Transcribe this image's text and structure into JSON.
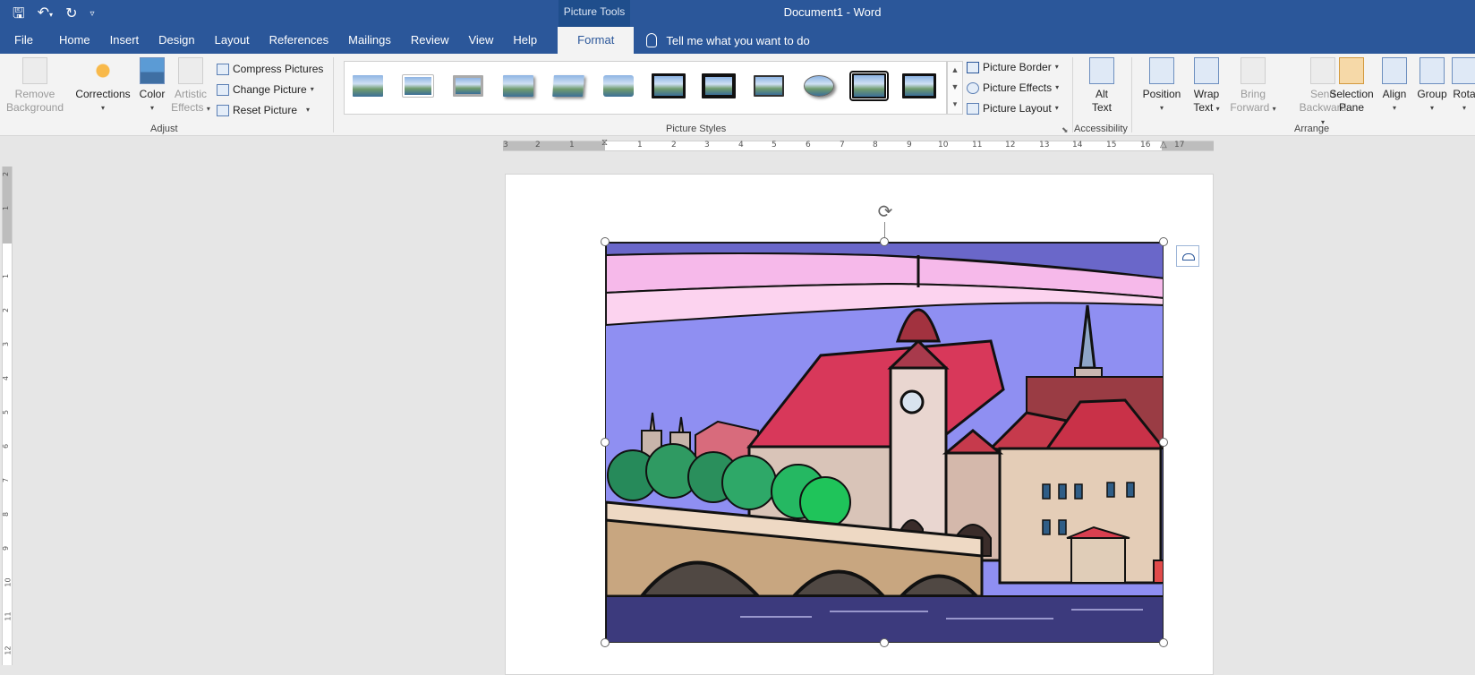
{
  "window": {
    "contextual_tab_group": "Picture Tools",
    "title": "Document1  -  Word",
    "qat_icons": [
      "save-icon",
      "undo-icon",
      "redo-icon",
      "customize-icon"
    ]
  },
  "tabs": [
    "File",
    "Home",
    "Insert",
    "Design",
    "Layout",
    "References",
    "Mailings",
    "Review",
    "View",
    "Help"
  ],
  "active_tab": "Format",
  "tell_me": "Tell me what you want to do",
  "ribbon": {
    "adjust": {
      "label": "Adjust",
      "remove_background": [
        "Remove",
        "Background"
      ],
      "corrections": "Corrections",
      "color": "Color",
      "artistic_effects": [
        "Artistic",
        "Effects"
      ],
      "compress": "Compress Pictures",
      "change": "Change Picture",
      "reset": "Reset Picture"
    },
    "picture_styles": {
      "label": "Picture Styles",
      "border": "Picture Border",
      "effects": "Picture Effects",
      "layout": "Picture Layout"
    },
    "accessibility": {
      "label": "Accessibility",
      "alt_text": [
        "Alt",
        "Text"
      ]
    },
    "arrange": {
      "label": "Arrange",
      "position": "Position",
      "wrap_text": [
        "Wrap",
        "Text"
      ],
      "bring_forward": [
        "Bring",
        "Forward"
      ],
      "send_backward": [
        "Send",
        "Backward"
      ],
      "selection_pane": [
        "Selection",
        "Pane"
      ],
      "align": "Align",
      "group": "Group",
      "rotate": "Rota"
    }
  },
  "ruler": {
    "h_labels": [
      "3",
      "2",
      "1",
      "1",
      "2",
      "3",
      "4",
      "5",
      "6",
      "7",
      "8",
      "9",
      "10",
      "11",
      "12",
      "13",
      "14",
      "15",
      "16",
      "17"
    ],
    "v_labels": [
      "2",
      "1",
      "1",
      "2",
      "3",
      "4",
      "5",
      "6",
      "7",
      "8",
      "9",
      "10",
      "11",
      "12"
    ]
  }
}
